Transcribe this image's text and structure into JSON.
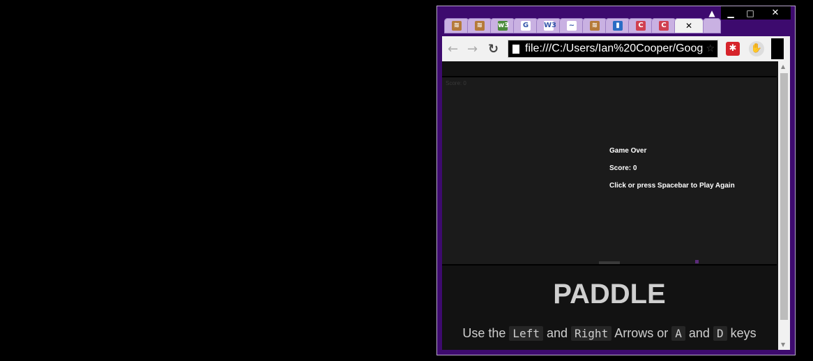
{
  "browser": {
    "tabs": [
      {
        "icon": "stackoverflow-icon",
        "color": "#b57a3a",
        "glyph": "≋"
      },
      {
        "icon": "stackoverflow-icon",
        "color": "#b57a3a",
        "glyph": "≋"
      },
      {
        "icon": "w3-icon-green",
        "color": "#4a8a3a",
        "glyph": "w3"
      },
      {
        "icon": "google-icon",
        "color": "#ffffff",
        "glyph": "G"
      },
      {
        "icon": "w3c-icon",
        "color": "#ffffff",
        "glyph": "W3"
      },
      {
        "icon": "mustache-icon",
        "color": "#ffffff",
        "glyph": "~"
      },
      {
        "icon": "stackoverflow-icon",
        "color": "#b57a3a",
        "glyph": "≋"
      },
      {
        "icon": "trello-icon",
        "color": "#2a6cc4",
        "glyph": "▮"
      },
      {
        "icon": "c-icon",
        "color": "#d04050",
        "glyph": "C"
      },
      {
        "icon": "c-icon",
        "color": "#d04050",
        "glyph": "C"
      }
    ],
    "active_tab_close": "✕",
    "url": "file:///C:/Users/Ian%20Cooper/Goog"
  },
  "game": {
    "score_small": "Score: 0",
    "game_over": "Game Over",
    "score": "Score: 0",
    "restart": "Click or press Spacebar to Play Again"
  },
  "page": {
    "title": "PADDLE",
    "instr_1": "Use the",
    "key_left": "Left",
    "instr_and1": "and",
    "key_right": "Right",
    "instr_2": "Arrows or",
    "key_a": "A",
    "instr_and2": "and",
    "key_d": "D",
    "instr_3": "keys"
  }
}
